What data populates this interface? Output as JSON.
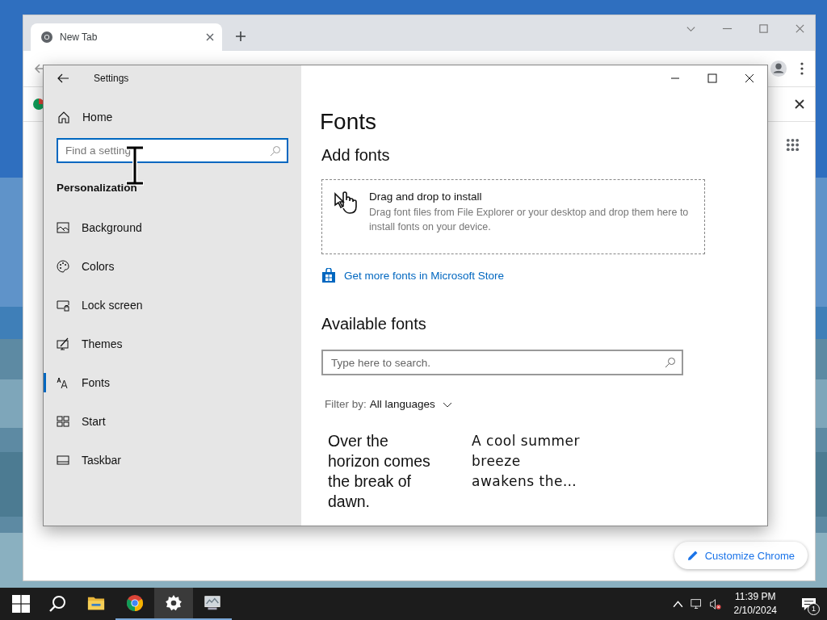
{
  "browser": {
    "tabs": [
      {
        "label": "New Tab",
        "selected": true
      }
    ],
    "customize_button": "Customize Chrome"
  },
  "settings": {
    "title": "Settings",
    "home": "Home",
    "search": {
      "placeholder": "Find a setting"
    },
    "section": "Personalization",
    "nav": [
      {
        "label": "Background",
        "kind": "background",
        "selected": false
      },
      {
        "label": "Colors",
        "kind": "palette",
        "selected": false
      },
      {
        "label": "Lock screen",
        "kind": "lock",
        "selected": false
      },
      {
        "label": "Themes",
        "kind": "themes",
        "selected": false
      },
      {
        "label": "Fonts",
        "kind": "fonts",
        "selected": true
      },
      {
        "label": "Start",
        "kind": "start",
        "selected": false
      },
      {
        "label": "Taskbar",
        "kind": "taskbar",
        "selected": false
      }
    ],
    "page_title": "Fonts",
    "add_heading": "Add fonts",
    "drop_title": "Drag and drop to install",
    "drop_text": "Drag font files from File Explorer or your desktop and drop them here to install fonts on your device.",
    "store_link": "Get more fonts in Microsoft Store",
    "available_heading": "Available fonts",
    "font_search": {
      "placeholder": "Type here to search."
    },
    "filter_label": "Filter by:",
    "filter_value": "All languages",
    "previews": [
      {
        "text": "Over the horizon comes the break of dawn.",
        "kind": "sans"
      },
      {
        "text": "A cool summer breeze awakens the…",
        "kind": "wide"
      }
    ]
  },
  "taskbar": {
    "apps": [
      {
        "kind": "explorer",
        "active": false,
        "running": false
      },
      {
        "kind": "chrome",
        "active": false,
        "running": true
      },
      {
        "kind": "settings",
        "active": true,
        "running": true
      },
      {
        "kind": "monitor",
        "active": false,
        "running": true
      }
    ],
    "time": "11:39 PM",
    "date": "2/10/2024",
    "notification_count": "1"
  }
}
